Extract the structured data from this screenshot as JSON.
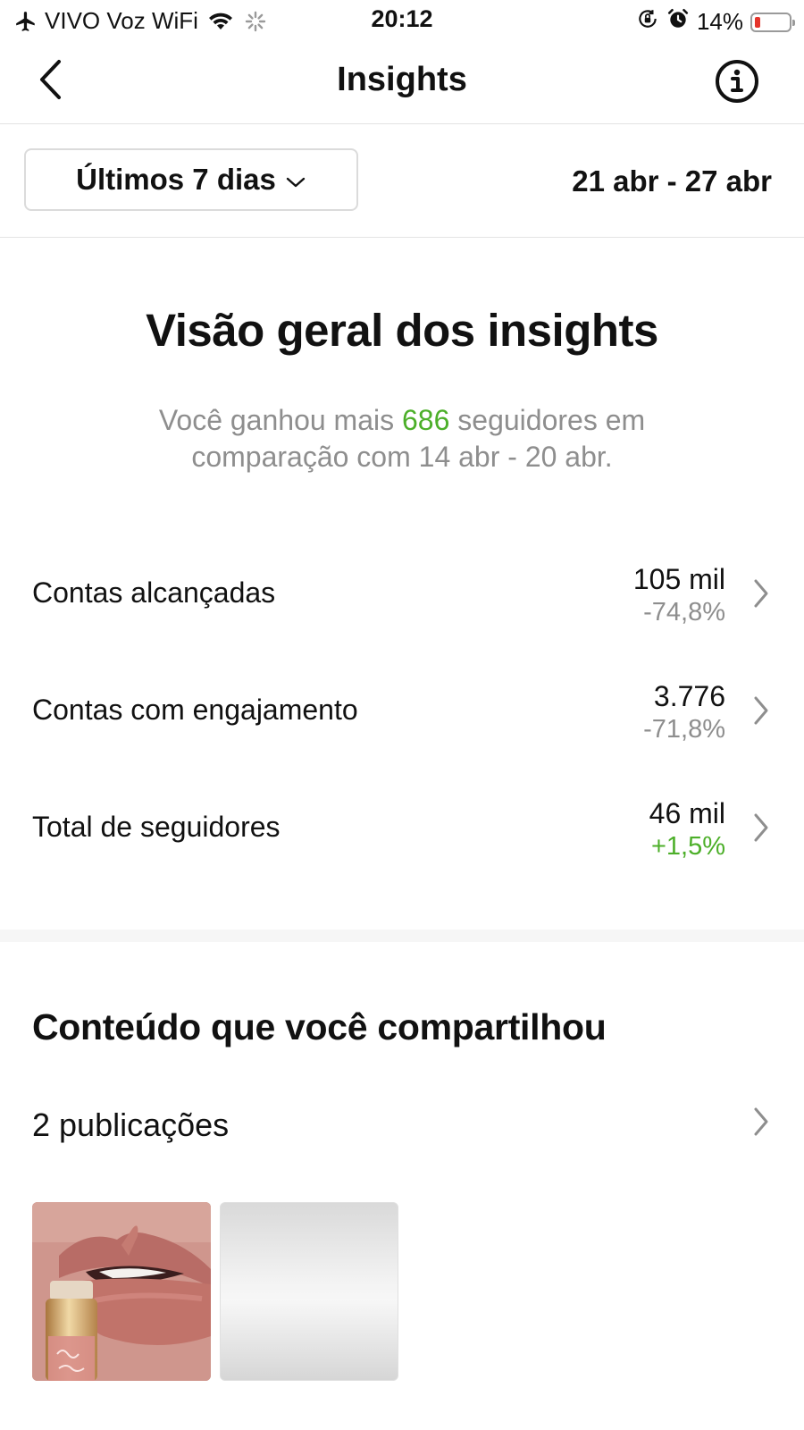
{
  "status_bar": {
    "carrier": "VIVO Voz WiFi",
    "time": "20:12",
    "battery": "14%",
    "battery_level": 0.14,
    "icons": [
      "airplane-icon",
      "wifi-icon",
      "loading-spinner-icon",
      "orientation-lock-icon",
      "alarm-icon",
      "battery-icon"
    ]
  },
  "nav": {
    "title": "Insights",
    "back_icon": "chevron-left-icon",
    "info_icon": "info-icon"
  },
  "filter": {
    "period": "Últimos 7 dias",
    "date_range": "21 abr - 27 abr"
  },
  "overview": {
    "title": "Visão geral dos insights",
    "subtitle_prefix": "Você ganhou mais ",
    "subtitle_count": "686",
    "subtitle_suffix": " seguidores em comparação com 14 abr - 20 abr.",
    "metrics": [
      {
        "label": "Contas alcançadas",
        "value": "105 mil",
        "change": "-74,8%"
      },
      {
        "label": "Contas com engajamento",
        "value": "3.776",
        "change": "-71,8%"
      },
      {
        "label": "Total de seguidores",
        "value": "46 mil",
        "change": "+1,5%"
      }
    ]
  },
  "content": {
    "title": "Conteúdo que você compartilhou",
    "posts_label": "2 publicações"
  },
  "colors": {
    "positive": "#4caf29",
    "muted": "#8e8e8e",
    "text": "#111111",
    "divider": "#e3e3e3"
  }
}
